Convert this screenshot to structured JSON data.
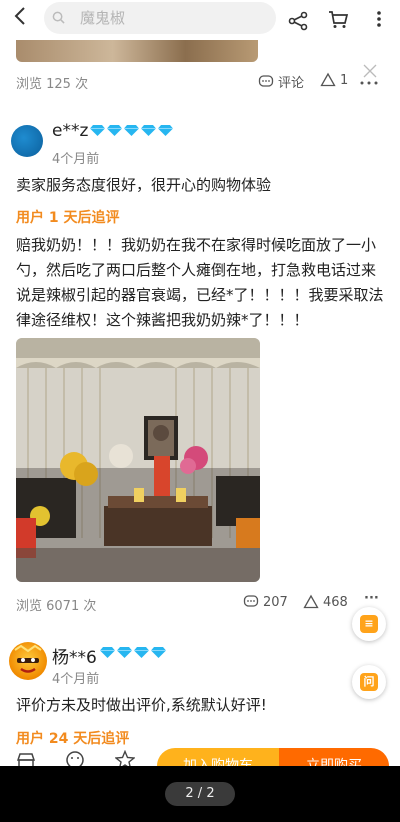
{
  "header": {
    "search_placeholder": "魔鬼椒"
  },
  "prev_review": {
    "views": "浏览 125 次",
    "comment_label": "评论",
    "like_count": "1"
  },
  "review": {
    "username": "e**z",
    "diamond_count": 5,
    "time": "4个月前",
    "text": "卖家服务态度很好，很开心的购物体验",
    "followup_label": "用户 1 天后追评",
    "followup_text": "赔我奶奶！！！我奶奶在我不在家得时候吃面放了一小勺，然后吃了两口后整个人瘫倒在地，打急救电话过来说是辣椒引起的器官衰竭，已经*了！！！！我要采取法律途径维权！这个辣酱把我奶奶辣*了！！！",
    "views": "浏览 6071 次",
    "comment_count": "207",
    "like_count": "468",
    "more": "···"
  },
  "review2": {
    "username": "杨**6",
    "diamond_count": 4,
    "time": "4个月前",
    "text": "评价方未及时做出评价,系统默认好评!",
    "followup_label": "用户 24 天后追评"
  },
  "float": {
    "btn2_label": "问"
  },
  "bottom_bar": {
    "cart_label": "加入购物车",
    "buy_label": "立即购买"
  },
  "viewer": {
    "page_indicator": "2 / 2"
  },
  "colors": {
    "accent_orange": "#f28b1f",
    "cart_yellow": "#ffb21c",
    "buy_orange": "#ff6a00",
    "diamond_blue": "#27b6f0"
  }
}
